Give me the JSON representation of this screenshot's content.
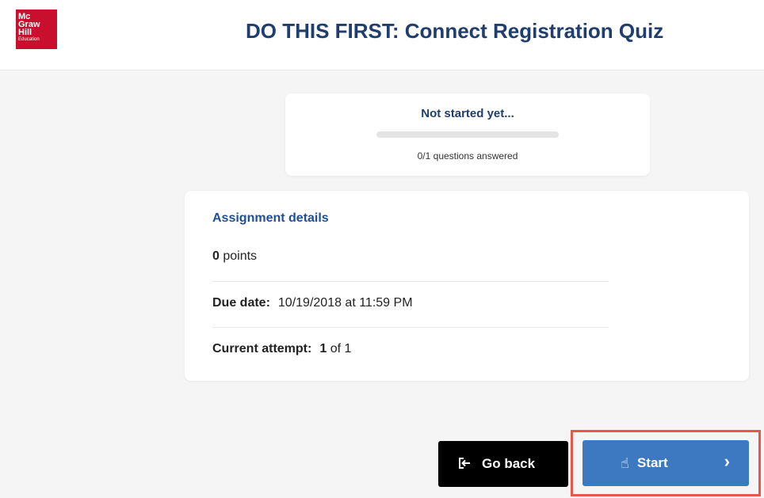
{
  "header": {
    "logo_lines": [
      "Mc",
      "Graw",
      "Hill",
      "Education"
    ],
    "title": "DO THIS FIRST: Connect Registration Quiz"
  },
  "progress": {
    "status": "Not started yet...",
    "answered_text": "0/1 questions answered",
    "fraction_complete": 0
  },
  "details": {
    "heading": "Assignment details",
    "points_value": "0",
    "points_label": "points",
    "due_label": "Due date:",
    "due_value": "10/19/2018 at 11:59 PM",
    "attempt_label": "Current attempt:",
    "attempt_current": "1",
    "attempt_total": "of 1"
  },
  "actions": {
    "go_back_label": "Go back",
    "start_label": "Start"
  },
  "colors": {
    "brand_red": "#c8102e",
    "title_blue": "#1f3e6e",
    "start_blue": "#3c79c0",
    "highlight": "#e8574a"
  },
  "icons": {
    "go_back": "exit-arrow-icon",
    "cursor": "hand-pointer-icon",
    "chevron": "chevron-right-icon"
  }
}
